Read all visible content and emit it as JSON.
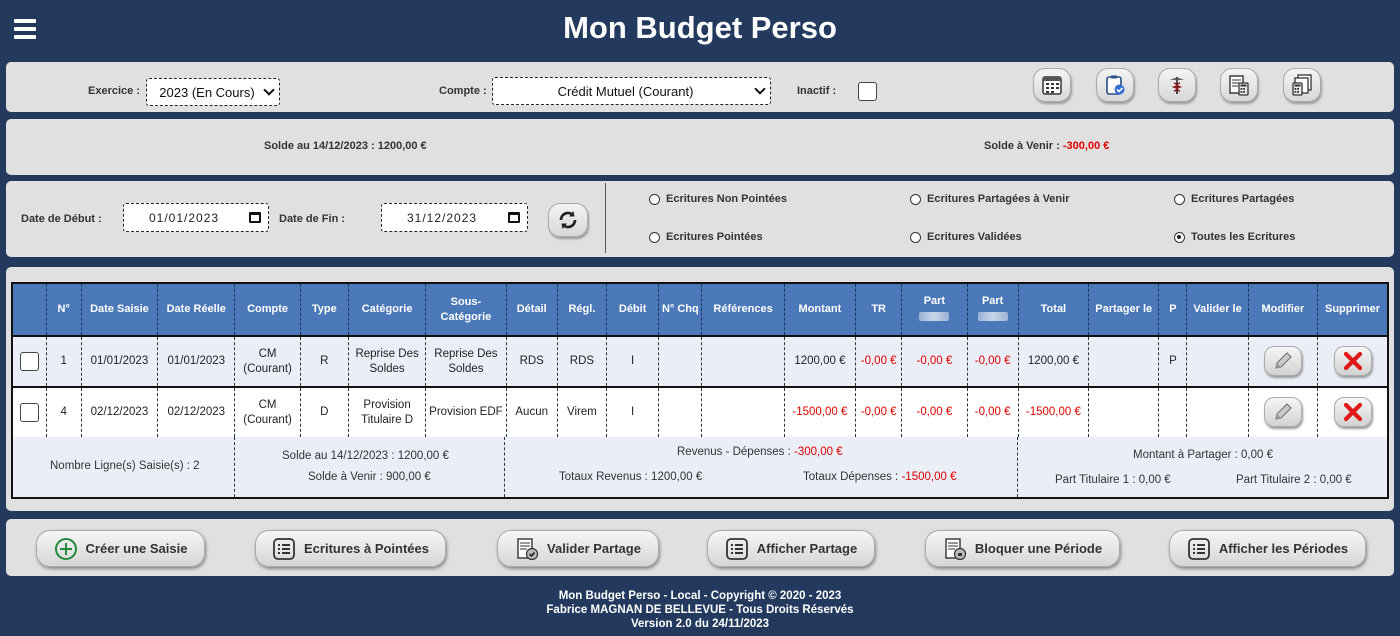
{
  "app": {
    "title": "Mon Budget Perso"
  },
  "filters": {
    "exercice_label": "Exercice :",
    "exercice_value": "2023 (En Cours)",
    "compte_label": "Compte :",
    "compte_value": "Crédit Mutuel (Courant)",
    "inactif_label": "Inactif :"
  },
  "toolbar": {
    "icons": [
      "calendar-grid-icon",
      "clipboard-check-icon",
      "caduceus-icon",
      "calculator-sheet-icon",
      "calculator-stack-icon"
    ]
  },
  "balance": {
    "solde_label": "Solde au 14/12/2023 : 1200,00 €",
    "avenir_label": "Solde à Venir :",
    "avenir_value": "-300,00 €"
  },
  "dates": {
    "debut_label": "Date de Début :",
    "debut_value": "01/01/2023",
    "fin_label": "Date de Fin :",
    "fin_value": "31/12/2023"
  },
  "radios": [
    {
      "label": "Ecritures Non Pointées",
      "checked": false
    },
    {
      "label": "Ecritures Partagées à Venir",
      "checked": false
    },
    {
      "label": "Ecritures Partagées",
      "checked": false
    },
    {
      "label": "Ecritures Pointées",
      "checked": false
    },
    {
      "label": "Ecritures Validées",
      "checked": false
    },
    {
      "label": "Toutes les Ecritures",
      "checked": true
    }
  ],
  "table": {
    "headers": [
      "",
      "N°",
      "Date Saisie",
      "Date Réelle",
      "Compte",
      "Type",
      "Catégorie",
      "Sous-Catégorie",
      "Détail",
      "Régl.",
      "Débit",
      "N° Chq",
      "Références",
      "Montant",
      "TR",
      "Part",
      "Part",
      "Total",
      "Partager le",
      "P",
      "Valider le",
      "Modifier",
      "Supprimer"
    ],
    "rows": [
      {
        "num": "1",
        "date_saisie": "01/01/2023",
        "date_reelle": "01/01/2023",
        "compte": "CM (Courant)",
        "type": "R",
        "categorie": "Reprise Des Soldes",
        "sous_categorie": "Reprise Des Soldes",
        "detail": "RDS",
        "regl": "RDS",
        "debit": "I",
        "chq": "",
        "references": "",
        "montant": "1200,00 €",
        "tr": "-0,00 €",
        "part1": "-0,00 €",
        "part2": "-0,00 €",
        "total": "1200,00 €",
        "partager": "",
        "p": "P",
        "valider": ""
      },
      {
        "num": "4",
        "date_saisie": "02/12/2023",
        "date_reelle": "02/12/2023",
        "compte": "CM (Courant)",
        "type": "D",
        "categorie": "Provision Titulaire D",
        "sous_categorie": "Provision EDF",
        "detail": "Aucun",
        "regl": "Virem",
        "debit": "I",
        "chq": "",
        "references": "",
        "montant": "-1500,00 €",
        "tr": "-0,00 €",
        "part1": "-0,00 €",
        "part2": "-0,00 €",
        "total": "-1500,00 €",
        "partager": "",
        "p": "",
        "valider": ""
      }
    ]
  },
  "summary": {
    "nb_lignes": "Nombre Ligne(s) Saisie(s) : 2",
    "solde": "Solde au 14/12/2023 : 1200,00 €",
    "solde_avenir": "Solde à Venir : 900,00 €",
    "rev_dep_label": "Revenus - Dépenses :",
    "rev_dep_value": "-300,00 €",
    "totaux_revenus": "Totaux Revenus : 1200,00 €",
    "totaux_depenses_label": "Totaux Dépenses :",
    "totaux_depenses_value": "-1500,00 €",
    "montant_partager": "Montant à Partager : 0,00 €",
    "part_titulaire_1": "Part Titulaire 1 : 0,00 €",
    "part_titulaire_2": "Part Titulaire 2 : 0,00 €"
  },
  "actions": {
    "create": "Créer une Saisie",
    "pointees": "Ecritures à Pointées",
    "valider_partage": "Valider Partage",
    "afficher_partage": "Afficher Partage",
    "bloquer": "Bloquer une Période",
    "afficher_periodes": "Afficher les Périodes"
  },
  "footer": {
    "line1": "Mon Budget Perso - Local - Copyright © 2020 - 2023",
    "line2": "Fabrice MAGNAN DE BELLEVUE - Tous Droits Réservés",
    "line3": "Version 2.0 du 24/11/2023"
  },
  "colors": {
    "background": "#233a5e",
    "panel": "#e0e0e0",
    "table_header": "#4a78b8",
    "negative": "#e00000"
  }
}
